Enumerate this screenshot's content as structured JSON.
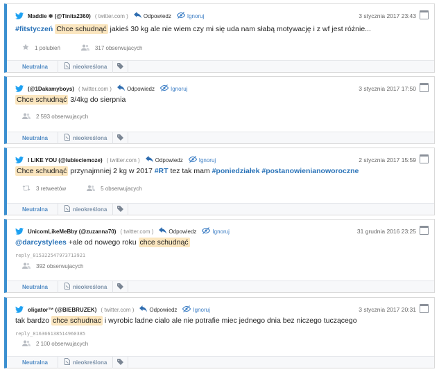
{
  "actions": {
    "reply": "Odpowiedz",
    "ignore": "Ignoruj"
  },
  "footer": {
    "sentiment": "Neutralna",
    "category": "nieokreślona"
  },
  "mentions": [
    {
      "author": "Maddie ❄ (@Tinita2360)",
      "source": "( twitter.com )",
      "date": "3 stycznia 2017 23:43",
      "segments": [
        {
          "t": "#fitstyczeń",
          "k": "hash"
        },
        {
          "t": " ",
          "k": "plain"
        },
        {
          "t": "Chce schudnąć",
          "k": "hl"
        },
        {
          "t": " jakieś 30 kg ale nie wiem czy mi się uda nam słabą motywację i z wf jest różnie...",
          "k": "plain"
        }
      ],
      "reply_id": "",
      "meta": [
        {
          "icon": "star-icon",
          "text": "1 polubień"
        },
        {
          "icon": "users-icon",
          "text": "317 obserwujacych"
        }
      ]
    },
    {
      "author": "(@1Dakamyboys)",
      "source": "( twitter.com )",
      "date": "3 stycznia 2017 17:50",
      "segments": [
        {
          "t": "Chce schudnąć",
          "k": "hl"
        },
        {
          "t": " 3/4kg do sierpnia",
          "k": "plain"
        }
      ],
      "reply_id": "",
      "meta": [
        {
          "icon": "users-icon",
          "text": "2 593 obserwujacych"
        }
      ]
    },
    {
      "author": "I LIKE YOU (@lubieciemoze)",
      "source": "( twitter.com )",
      "date": "2 stycznia 2017 15:59",
      "segments": [
        {
          "t": "Chce schudnąć",
          "k": "hl"
        },
        {
          "t": " przynajmniej 2 kg w 2017 ",
          "k": "plain"
        },
        {
          "t": "#RT",
          "k": "hash"
        },
        {
          "t": " tez tak mam ",
          "k": "plain"
        },
        {
          "t": "#poniedziałek",
          "k": "hash"
        },
        {
          "t": " ",
          "k": "plain"
        },
        {
          "t": "#postanowienianoworoczne",
          "k": "hash"
        }
      ],
      "reply_id": "",
      "meta": [
        {
          "icon": "retweet-icon",
          "text": "3 retweetów"
        },
        {
          "icon": "users-icon",
          "text": "5 obserwujacych"
        }
      ]
    },
    {
      "author": "UnicomLikeMeBby (@zuzanna70)",
      "source": "( twitter.com )",
      "date": "31 grudnia 2016 23:25",
      "segments": [
        {
          "t": "@darcystylees",
          "k": "hash"
        },
        {
          "t": " +ale od nowego roku ",
          "k": "plain"
        },
        {
          "t": "chce schudnąć",
          "k": "hl"
        }
      ],
      "reply_id": "reply_815322547973713921",
      "meta": [
        {
          "icon": "users-icon",
          "text": "392 obserwujacych"
        }
      ]
    },
    {
      "author": "oligator™ (@BIEBRUZEK)",
      "source": "( twitter.com )",
      "date": "3 stycznia 2017 20:31",
      "segments": [
        {
          "t": "tak bardzo ",
          "k": "plain"
        },
        {
          "t": "chce schudnac",
          "k": "hl"
        },
        {
          "t": " i wyrobic ladne cialo ale nie potrafie miec jednego dnia bez niczego tuczącego",
          "k": "plain"
        }
      ],
      "reply_id": "reply_816366138514960385",
      "meta": [
        {
          "icon": "users-icon",
          "text": "2 100 obserwujacych"
        }
      ]
    }
  ]
}
